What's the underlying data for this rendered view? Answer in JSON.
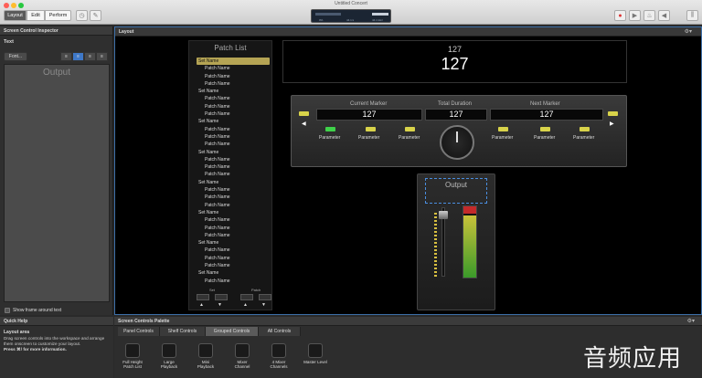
{
  "window": {
    "title": "Untitled Concert"
  },
  "toolbar": {
    "modes": [
      "Layout",
      "Edit",
      "Perform"
    ],
    "active_mode": "Layout",
    "lcd": {
      "left_text": "0%",
      "mid_text": "44.1 k",
      "right_text": "44.1 kHz"
    }
  },
  "inspector": {
    "title": "Screen Control Inspector",
    "section": "Text",
    "font_button": "Font...",
    "preview_text": "Output",
    "frame_checkbox": "Show frame around text"
  },
  "layout_panel": {
    "title": "Layout",
    "patch_list": {
      "title": "Patch List",
      "items": [
        {
          "type": "set",
          "label": "Set Name",
          "selected": true
        },
        {
          "type": "patch",
          "label": "Patch Name"
        },
        {
          "type": "patch",
          "label": "Patch Name"
        },
        {
          "type": "patch",
          "label": "Patch Name"
        },
        {
          "type": "set",
          "label": "Set Name"
        },
        {
          "type": "patch",
          "label": "Patch Name"
        },
        {
          "type": "patch",
          "label": "Patch Name"
        },
        {
          "type": "patch",
          "label": "Patch Name"
        },
        {
          "type": "set",
          "label": "Set Name"
        },
        {
          "type": "patch",
          "label": "Patch Name"
        },
        {
          "type": "patch",
          "label": "Patch Name"
        },
        {
          "type": "patch",
          "label": "Patch Name"
        },
        {
          "type": "set",
          "label": "Set Name"
        },
        {
          "type": "patch",
          "label": "Patch Name"
        },
        {
          "type": "patch",
          "label": "Patch Name"
        },
        {
          "type": "patch",
          "label": "Patch Name"
        },
        {
          "type": "set",
          "label": "Set Name"
        },
        {
          "type": "patch",
          "label": "Patch Name"
        },
        {
          "type": "patch",
          "label": "Patch Name"
        },
        {
          "type": "patch",
          "label": "Patch Name"
        },
        {
          "type": "set",
          "label": "Set Name"
        },
        {
          "type": "patch",
          "label": "Patch Name"
        },
        {
          "type": "patch",
          "label": "Patch Name"
        },
        {
          "type": "patch",
          "label": "Patch Name"
        },
        {
          "type": "set",
          "label": "Set Name"
        },
        {
          "type": "patch",
          "label": "Patch Name"
        },
        {
          "type": "patch",
          "label": "Patch Name"
        },
        {
          "type": "patch",
          "label": "Patch Name"
        },
        {
          "type": "set",
          "label": "Set Name"
        },
        {
          "type": "patch",
          "label": "Patch Name"
        }
      ],
      "set_label": "Set",
      "patch_label": "Patch",
      "up_arrow": "▲",
      "down_arrow": "▼"
    },
    "display": {
      "small": "127",
      "large": "127"
    },
    "markers": {
      "current_label": "Current Marker",
      "current_value": "127",
      "duration_label": "Total Duration",
      "duration_value": "127",
      "next_label": "Next Marker",
      "next_value": "127",
      "param_labels": [
        "Parameter",
        "Parameter",
        "Parameter",
        "Parameter",
        "Parameter",
        "Parameter"
      ],
      "left_arrow": "◀",
      "right_arrow": "▶"
    },
    "output_strip": {
      "label": "Output"
    }
  },
  "quick_help": {
    "title": "Quick Help",
    "heading": "Layout area",
    "body": "Drag screen controls into the workspace and arrange them onscreen to customize your layout.",
    "bold": "Press ⌘/ for more information."
  },
  "palette": {
    "title": "Screen Controls Palette",
    "tabs": [
      "Panel Controls",
      "Shelf Controls",
      "Grouped Controls",
      "All Controls"
    ],
    "active_tab": "Grouped Controls",
    "items": [
      {
        "label": "Full Height\nPatch List",
        "icon": "patch-list-icon"
      },
      {
        "label": "Large\nPlayback",
        "icon": "playback-large-icon"
      },
      {
        "label": "Mini\nPlayback",
        "icon": "playback-mini-icon"
      },
      {
        "label": "Mixer\nChannel",
        "icon": "mixer-channel-icon"
      },
      {
        "label": "4 Mixer\nChannels",
        "icon": "mixer-4channels-icon"
      },
      {
        "label": "Master Level",
        "icon": "master-level-icon"
      }
    ]
  },
  "watermark": "音频应用",
  "colors": {
    "accent_border": "#3d6fa8",
    "selection": "#b5a454",
    "led_green": "#3fd24a",
    "led_yellow": "#d8d34a",
    "meter_red": "#c42a2a"
  }
}
